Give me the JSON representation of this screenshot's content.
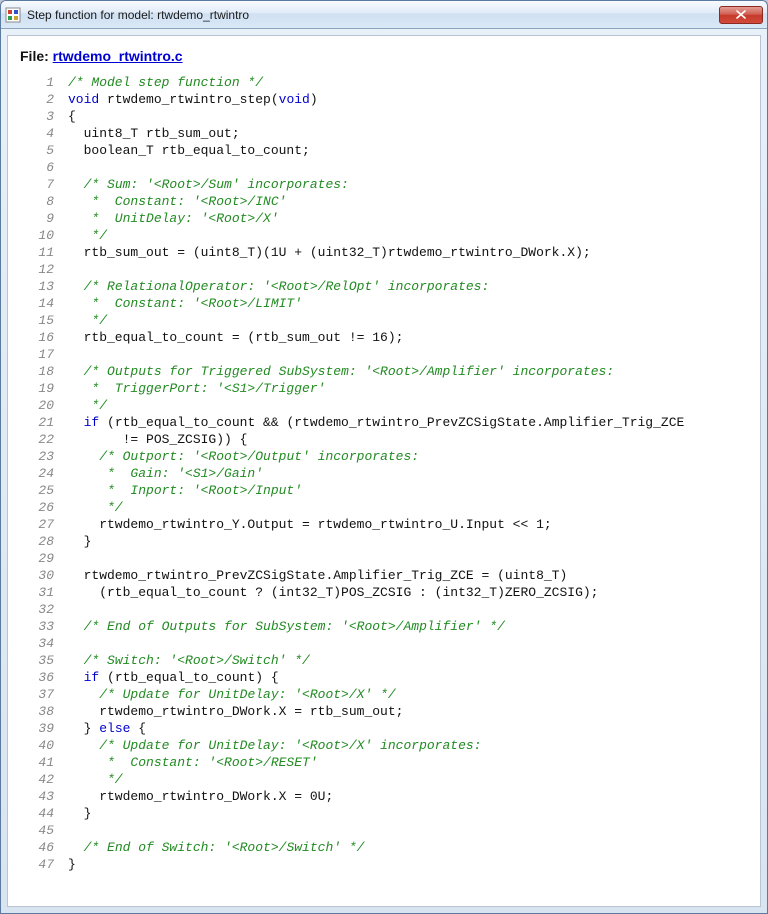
{
  "window": {
    "title": "Step function for model: rtwdemo_rtwintro",
    "close_tooltip": "Close"
  },
  "header": {
    "label": "File: ",
    "filename": "rtwdemo_rtwintro.c"
  },
  "code_lines": [
    {
      "n": 1,
      "tokens": [
        {
          "cls": "c-comment",
          "t": "/* Model step function */"
        }
      ]
    },
    {
      "n": 2,
      "tokens": [
        {
          "cls": "c-kw",
          "t": "void"
        },
        {
          "cls": "c-txt",
          "t": " rtwdemo_rtwintro_step("
        },
        {
          "cls": "c-kw",
          "t": "void"
        },
        {
          "cls": "c-txt",
          "t": ")"
        }
      ]
    },
    {
      "n": 3,
      "tokens": [
        {
          "cls": "c-txt",
          "t": "{"
        }
      ]
    },
    {
      "n": 4,
      "tokens": [
        {
          "cls": "c-txt",
          "t": "  uint8_T rtb_sum_out;"
        }
      ]
    },
    {
      "n": 5,
      "tokens": [
        {
          "cls": "c-txt",
          "t": "  boolean_T rtb_equal_to_count;"
        }
      ]
    },
    {
      "n": 6,
      "tokens": []
    },
    {
      "n": 7,
      "tokens": [
        {
          "cls": "c-txt",
          "t": "  "
        },
        {
          "cls": "c-comment",
          "t": "/* Sum: '<Root>/Sum' incorporates:"
        }
      ]
    },
    {
      "n": 8,
      "tokens": [
        {
          "cls": "c-comment",
          "t": "   *  Constant: '<Root>/INC'"
        }
      ]
    },
    {
      "n": 9,
      "tokens": [
        {
          "cls": "c-comment",
          "t": "   *  UnitDelay: '<Root>/X'"
        }
      ]
    },
    {
      "n": 10,
      "tokens": [
        {
          "cls": "c-comment",
          "t": "   */"
        }
      ]
    },
    {
      "n": 11,
      "tokens": [
        {
          "cls": "c-txt",
          "t": "  rtb_sum_out = (uint8_T)(1U + (uint32_T)rtwdemo_rtwintro_DWork.X);"
        }
      ]
    },
    {
      "n": 12,
      "tokens": []
    },
    {
      "n": 13,
      "tokens": [
        {
          "cls": "c-txt",
          "t": "  "
        },
        {
          "cls": "c-comment",
          "t": "/* RelationalOperator: '<Root>/RelOpt' incorporates:"
        }
      ]
    },
    {
      "n": 14,
      "tokens": [
        {
          "cls": "c-comment",
          "t": "   *  Constant: '<Root>/LIMIT'"
        }
      ]
    },
    {
      "n": 15,
      "tokens": [
        {
          "cls": "c-comment",
          "t": "   */"
        }
      ]
    },
    {
      "n": 16,
      "tokens": [
        {
          "cls": "c-txt",
          "t": "  rtb_equal_to_count = (rtb_sum_out != 16);"
        }
      ]
    },
    {
      "n": 17,
      "tokens": []
    },
    {
      "n": 18,
      "tokens": [
        {
          "cls": "c-txt",
          "t": "  "
        },
        {
          "cls": "c-comment",
          "t": "/* Outputs for Triggered SubSystem: '<Root>/Amplifier' incorporates:"
        }
      ]
    },
    {
      "n": 19,
      "tokens": [
        {
          "cls": "c-comment",
          "t": "   *  TriggerPort: '<S1>/Trigger'"
        }
      ]
    },
    {
      "n": 20,
      "tokens": [
        {
          "cls": "c-comment",
          "t": "   */"
        }
      ]
    },
    {
      "n": 21,
      "tokens": [
        {
          "cls": "c-txt",
          "t": "  "
        },
        {
          "cls": "c-kw",
          "t": "if"
        },
        {
          "cls": "c-txt",
          "t": " (rtb_equal_to_count && (rtwdemo_rtwintro_PrevZCSigState.Amplifier_Trig_ZCE"
        }
      ]
    },
    {
      "n": 22,
      "tokens": [
        {
          "cls": "c-txt",
          "t": "       != POS_ZCSIG)) {"
        }
      ]
    },
    {
      "n": 23,
      "tokens": [
        {
          "cls": "c-txt",
          "t": "    "
        },
        {
          "cls": "c-comment",
          "t": "/* Outport: '<Root>/Output' incorporates:"
        }
      ]
    },
    {
      "n": 24,
      "tokens": [
        {
          "cls": "c-comment",
          "t": "     *  Gain: '<S1>/Gain'"
        }
      ]
    },
    {
      "n": 25,
      "tokens": [
        {
          "cls": "c-comment",
          "t": "     *  Inport: '<Root>/Input'"
        }
      ]
    },
    {
      "n": 26,
      "tokens": [
        {
          "cls": "c-comment",
          "t": "     */"
        }
      ]
    },
    {
      "n": 27,
      "tokens": [
        {
          "cls": "c-txt",
          "t": "    rtwdemo_rtwintro_Y.Output = rtwdemo_rtwintro_U.Input << 1;"
        }
      ]
    },
    {
      "n": 28,
      "tokens": [
        {
          "cls": "c-txt",
          "t": "  }"
        }
      ]
    },
    {
      "n": 29,
      "tokens": []
    },
    {
      "n": 30,
      "tokens": [
        {
          "cls": "c-txt",
          "t": "  rtwdemo_rtwintro_PrevZCSigState.Amplifier_Trig_ZCE = (uint8_T)"
        }
      ]
    },
    {
      "n": 31,
      "tokens": [
        {
          "cls": "c-txt",
          "t": "    (rtb_equal_to_count ? (int32_T)POS_ZCSIG : (int32_T)ZERO_ZCSIG);"
        }
      ]
    },
    {
      "n": 32,
      "tokens": []
    },
    {
      "n": 33,
      "tokens": [
        {
          "cls": "c-txt",
          "t": "  "
        },
        {
          "cls": "c-comment",
          "t": "/* End of Outputs for SubSystem: '<Root>/Amplifier' */"
        }
      ]
    },
    {
      "n": 34,
      "tokens": []
    },
    {
      "n": 35,
      "tokens": [
        {
          "cls": "c-txt",
          "t": "  "
        },
        {
          "cls": "c-comment",
          "t": "/* Switch: '<Root>/Switch' */"
        }
      ]
    },
    {
      "n": 36,
      "tokens": [
        {
          "cls": "c-txt",
          "t": "  "
        },
        {
          "cls": "c-kw",
          "t": "if"
        },
        {
          "cls": "c-txt",
          "t": " (rtb_equal_to_count) {"
        }
      ]
    },
    {
      "n": 37,
      "tokens": [
        {
          "cls": "c-txt",
          "t": "    "
        },
        {
          "cls": "c-comment",
          "t": "/* Update for UnitDelay: '<Root>/X' */"
        }
      ]
    },
    {
      "n": 38,
      "tokens": [
        {
          "cls": "c-txt",
          "t": "    rtwdemo_rtwintro_DWork.X = rtb_sum_out;"
        }
      ]
    },
    {
      "n": 39,
      "tokens": [
        {
          "cls": "c-txt",
          "t": "  } "
        },
        {
          "cls": "c-kw",
          "t": "else"
        },
        {
          "cls": "c-txt",
          "t": " {"
        }
      ]
    },
    {
      "n": 40,
      "tokens": [
        {
          "cls": "c-txt",
          "t": "    "
        },
        {
          "cls": "c-comment",
          "t": "/* Update for UnitDelay: '<Root>/X' incorporates:"
        }
      ]
    },
    {
      "n": 41,
      "tokens": [
        {
          "cls": "c-comment",
          "t": "     *  Constant: '<Root>/RESET'"
        }
      ]
    },
    {
      "n": 42,
      "tokens": [
        {
          "cls": "c-comment",
          "t": "     */"
        }
      ]
    },
    {
      "n": 43,
      "tokens": [
        {
          "cls": "c-txt",
          "t": "    rtwdemo_rtwintro_DWork.X = 0U;"
        }
      ]
    },
    {
      "n": 44,
      "tokens": [
        {
          "cls": "c-txt",
          "t": "  }"
        }
      ]
    },
    {
      "n": 45,
      "tokens": []
    },
    {
      "n": 46,
      "tokens": [
        {
          "cls": "c-txt",
          "t": "  "
        },
        {
          "cls": "c-comment",
          "t": "/* End of Switch: '<Root>/Switch' */"
        }
      ]
    },
    {
      "n": 47,
      "tokens": [
        {
          "cls": "c-txt",
          "t": "}"
        }
      ]
    }
  ]
}
